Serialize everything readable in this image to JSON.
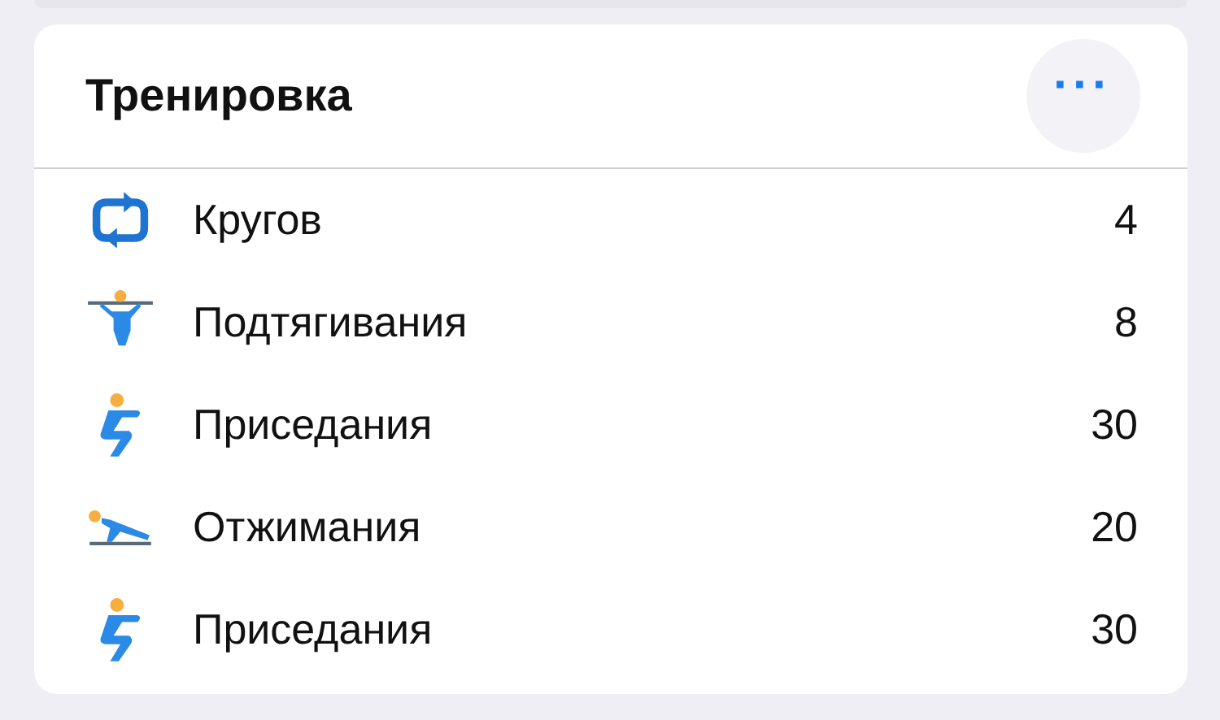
{
  "card": {
    "title": "Тренировка",
    "menu_button": "···"
  },
  "rows": [
    {
      "kind": "rounds",
      "label": "Кругов",
      "value": "4"
    },
    {
      "kind": "pullup",
      "label": "Подтягивания",
      "value": "8"
    },
    {
      "kind": "squat",
      "label": "Приседания",
      "value": "30"
    },
    {
      "kind": "pushup",
      "label": "Отжимания",
      "value": "20"
    },
    {
      "kind": "squat",
      "label": "Приседания",
      "value": "30"
    }
  ]
}
